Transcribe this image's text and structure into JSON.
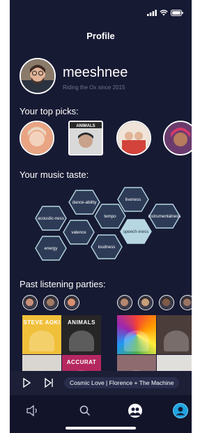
{
  "header": {
    "title": "Profile"
  },
  "profile": {
    "username": "meeshnee",
    "subtitle": "Riding the Ox since 2015",
    "avatar_icon": "user-avatar-photo"
  },
  "sections": {
    "top_picks": "Your top picks:",
    "music_taste": "Your music taste:",
    "past_parties": "Past listening parties:"
  },
  "top_picks": [
    {
      "name": "artist-pick-1",
      "shape": "round",
      "bg": "#e9a583"
    },
    {
      "name": "artist-pick-2",
      "shape": "square",
      "bg": "#2a2a2a",
      "caption": "ANIMALS"
    },
    {
      "name": "artist-pick-3",
      "shape": "round",
      "bg": "#d86a62"
    },
    {
      "name": "artist-pick-4",
      "shape": "round",
      "bg": "#6b3b6e"
    }
  ],
  "music_taste": [
    {
      "label": "dance-ability",
      "lines": [
        "dance-",
        "ability"
      ],
      "active": false
    },
    {
      "label": "liveness",
      "lines": [
        "liveness"
      ],
      "active": false
    },
    {
      "label": "acousticness",
      "lines": [
        "acoustic-",
        "ness"
      ],
      "active": false
    },
    {
      "label": "tempo",
      "lines": [
        "tempo"
      ],
      "active": false
    },
    {
      "label": "instrumentalness",
      "lines": [
        "instrument",
        "alness"
      ],
      "active": false
    },
    {
      "label": "valence",
      "lines": [
        "valence"
      ],
      "active": false
    },
    {
      "label": "speechiness",
      "lines": [
        "speech-",
        "iness"
      ],
      "active": true
    },
    {
      "label": "energy",
      "lines": [
        "energy"
      ],
      "active": false
    },
    {
      "label": "loudness",
      "lines": [
        "loudness"
      ],
      "active": false
    }
  ],
  "party_left_avatars": [
    "#c9907a",
    "#a07a64",
    "#d88f72"
  ],
  "party_right_avatars": [
    "#b5876f",
    "#c7a079",
    "#7f5a48",
    "#9a7563"
  ],
  "albums_left": [
    {
      "caption": "STEVE AOKI",
      "bg": "#f1c03a"
    },
    {
      "caption": "ANIMALS",
      "bg": "#262626"
    },
    {
      "caption": "",
      "bg": "#d9d6d1"
    },
    {
      "caption": "ACCURAT",
      "bg": "#b4285f"
    }
  ],
  "albums_right": [
    {
      "caption": "",
      "bg": "#e84b6d"
    },
    {
      "caption": "",
      "bg": "#4b3d3a"
    },
    {
      "caption": "",
      "bg": "#8e6b6e"
    },
    {
      "caption": "",
      "bg": "#e1dfdc"
    }
  ],
  "player": {
    "now_playing": "Cosmic Love | Florence + The Machine",
    "play_icon": "play-icon",
    "skip_icon": "skip-forward-icon"
  },
  "tabs": [
    {
      "name": "tab-speaker",
      "icon": "speaker-icon"
    },
    {
      "name": "tab-search",
      "icon": "search-icon"
    },
    {
      "name": "tab-party",
      "icon": "group-icon"
    },
    {
      "name": "tab-profile",
      "icon": "profile-icon"
    }
  ],
  "colors": {
    "background": "#171a33",
    "hex_fill": "#2d3b57",
    "hex_stroke": "#b6d7e1",
    "hex_active": "#b6d7e1",
    "accent": "#1fa3e0"
  }
}
